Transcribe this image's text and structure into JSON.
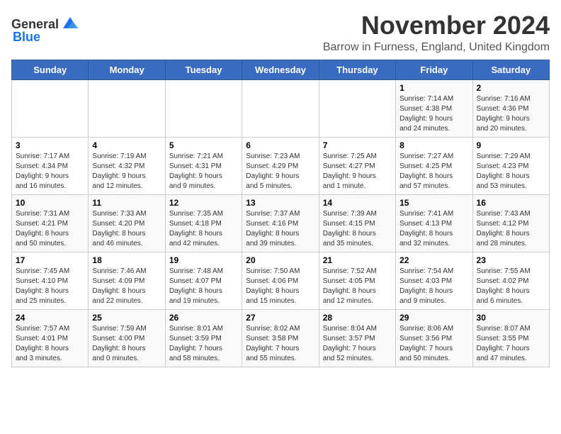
{
  "header": {
    "logo_general": "General",
    "logo_blue": "Blue",
    "title": "November 2024",
    "subtitle": "Barrow in Furness, England, United Kingdom"
  },
  "calendar": {
    "weekdays": [
      "Sunday",
      "Monday",
      "Tuesday",
      "Wednesday",
      "Thursday",
      "Friday",
      "Saturday"
    ],
    "weeks": [
      [
        {
          "day": "",
          "info": ""
        },
        {
          "day": "",
          "info": ""
        },
        {
          "day": "",
          "info": ""
        },
        {
          "day": "",
          "info": ""
        },
        {
          "day": "",
          "info": ""
        },
        {
          "day": "1",
          "info": "Sunrise: 7:14 AM\nSunset: 4:38 PM\nDaylight: 9 hours\nand 24 minutes."
        },
        {
          "day": "2",
          "info": "Sunrise: 7:16 AM\nSunset: 4:36 PM\nDaylight: 9 hours\nand 20 minutes."
        }
      ],
      [
        {
          "day": "3",
          "info": "Sunrise: 7:17 AM\nSunset: 4:34 PM\nDaylight: 9 hours\nand 16 minutes."
        },
        {
          "day": "4",
          "info": "Sunrise: 7:19 AM\nSunset: 4:32 PM\nDaylight: 9 hours\nand 12 minutes."
        },
        {
          "day": "5",
          "info": "Sunrise: 7:21 AM\nSunset: 4:31 PM\nDaylight: 9 hours\nand 9 minutes."
        },
        {
          "day": "6",
          "info": "Sunrise: 7:23 AM\nSunset: 4:29 PM\nDaylight: 9 hours\nand 5 minutes."
        },
        {
          "day": "7",
          "info": "Sunrise: 7:25 AM\nSunset: 4:27 PM\nDaylight: 9 hours\nand 1 minute."
        },
        {
          "day": "8",
          "info": "Sunrise: 7:27 AM\nSunset: 4:25 PM\nDaylight: 8 hours\nand 57 minutes."
        },
        {
          "day": "9",
          "info": "Sunrise: 7:29 AM\nSunset: 4:23 PM\nDaylight: 8 hours\nand 53 minutes."
        }
      ],
      [
        {
          "day": "10",
          "info": "Sunrise: 7:31 AM\nSunset: 4:21 PM\nDaylight: 8 hours\nand 50 minutes."
        },
        {
          "day": "11",
          "info": "Sunrise: 7:33 AM\nSunset: 4:20 PM\nDaylight: 8 hours\nand 46 minutes."
        },
        {
          "day": "12",
          "info": "Sunrise: 7:35 AM\nSunset: 4:18 PM\nDaylight: 8 hours\nand 42 minutes."
        },
        {
          "day": "13",
          "info": "Sunrise: 7:37 AM\nSunset: 4:16 PM\nDaylight: 8 hours\nand 39 minutes."
        },
        {
          "day": "14",
          "info": "Sunrise: 7:39 AM\nSunset: 4:15 PM\nDaylight: 8 hours\nand 35 minutes."
        },
        {
          "day": "15",
          "info": "Sunrise: 7:41 AM\nSunset: 4:13 PM\nDaylight: 8 hours\nand 32 minutes."
        },
        {
          "day": "16",
          "info": "Sunrise: 7:43 AM\nSunset: 4:12 PM\nDaylight: 8 hours\nand 28 minutes."
        }
      ],
      [
        {
          "day": "17",
          "info": "Sunrise: 7:45 AM\nSunset: 4:10 PM\nDaylight: 8 hours\nand 25 minutes."
        },
        {
          "day": "18",
          "info": "Sunrise: 7:46 AM\nSunset: 4:09 PM\nDaylight: 8 hours\nand 22 minutes."
        },
        {
          "day": "19",
          "info": "Sunrise: 7:48 AM\nSunset: 4:07 PM\nDaylight: 8 hours\nand 19 minutes."
        },
        {
          "day": "20",
          "info": "Sunrise: 7:50 AM\nSunset: 4:06 PM\nDaylight: 8 hours\nand 15 minutes."
        },
        {
          "day": "21",
          "info": "Sunrise: 7:52 AM\nSunset: 4:05 PM\nDaylight: 8 hours\nand 12 minutes."
        },
        {
          "day": "22",
          "info": "Sunrise: 7:54 AM\nSunset: 4:03 PM\nDaylight: 8 hours\nand 9 minutes."
        },
        {
          "day": "23",
          "info": "Sunrise: 7:55 AM\nSunset: 4:02 PM\nDaylight: 8 hours\nand 6 minutes."
        }
      ],
      [
        {
          "day": "24",
          "info": "Sunrise: 7:57 AM\nSunset: 4:01 PM\nDaylight: 8 hours\nand 3 minutes."
        },
        {
          "day": "25",
          "info": "Sunrise: 7:59 AM\nSunset: 4:00 PM\nDaylight: 8 hours\nand 0 minutes."
        },
        {
          "day": "26",
          "info": "Sunrise: 8:01 AM\nSunset: 3:59 PM\nDaylight: 7 hours\nand 58 minutes."
        },
        {
          "day": "27",
          "info": "Sunrise: 8:02 AM\nSunset: 3:58 PM\nDaylight: 7 hours\nand 55 minutes."
        },
        {
          "day": "28",
          "info": "Sunrise: 8:04 AM\nSunset: 3:57 PM\nDaylight: 7 hours\nand 52 minutes."
        },
        {
          "day": "29",
          "info": "Sunrise: 8:06 AM\nSunset: 3:56 PM\nDaylight: 7 hours\nand 50 minutes."
        },
        {
          "day": "30",
          "info": "Sunrise: 8:07 AM\nSunset: 3:55 PM\nDaylight: 7 hours\nand 47 minutes."
        }
      ]
    ]
  }
}
